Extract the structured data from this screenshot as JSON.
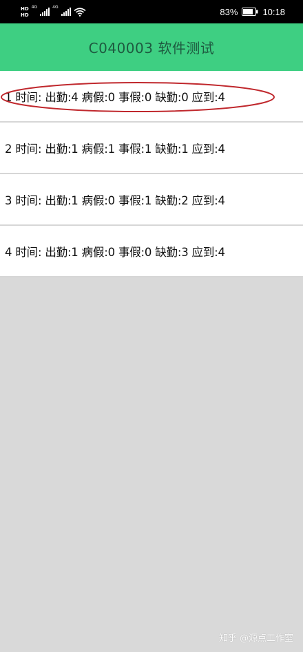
{
  "status_bar": {
    "hd_1": "HD",
    "hd_2": "HD",
    "net_1": "4G",
    "net_2": "4G",
    "battery_percent": "83%",
    "time": "10:18"
  },
  "app_bar": {
    "title": "C040003 软件测试",
    "background_color": "#3ecf82"
  },
  "records": [
    {
      "text": "1 时间: 出勤:4 病假:0 事假:0 缺勤:0 应到:4",
      "highlighted": true
    },
    {
      "text": "2 时间: 出勤:1 病假:1 事假:1 缺勤:1 应到:4",
      "highlighted": false
    },
    {
      "text": "3 时间: 出勤:1 病假:0 事假:1 缺勤:2 应到:4",
      "highlighted": false
    },
    {
      "text": "4 时间: 出勤:1 病假:0 事假:0 缺勤:3 应到:4",
      "highlighted": false
    }
  ],
  "annotation_color": "#c0282d",
  "watermark": "知乎 @源点工作室"
}
